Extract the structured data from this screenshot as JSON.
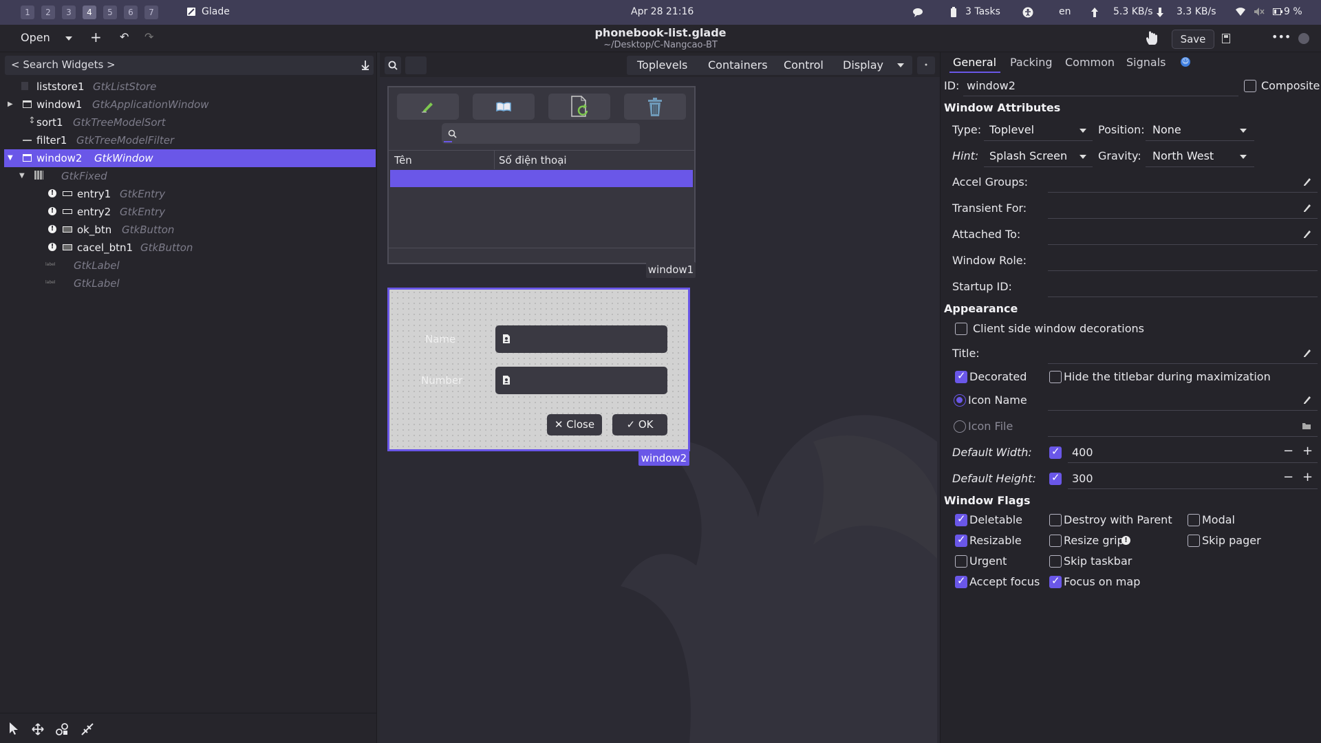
{
  "sysbar": {
    "workspaces": [
      "1",
      "2",
      "3",
      "4",
      "5",
      "6",
      "7"
    ],
    "app_name": "Glade",
    "datetime": "Apr 28  21:16",
    "tasks": "3 Tasks",
    "lang": "en",
    "net_up": "5.3 KB/s",
    "net_down": "3.3 KB/s",
    "battery": "9 %"
  },
  "header": {
    "open_label": "Open",
    "title": "phonebook-list.glade",
    "subtitle": "~/Desktop/C-Nangcao-BT",
    "save_label": "Save"
  },
  "left": {
    "search_label": "< Search Widgets >",
    "tree": [
      {
        "name": "liststore1",
        "type": "GtkListStore"
      },
      {
        "name": "window1",
        "type": "GtkApplicationWindow"
      },
      {
        "name": "sort1",
        "type": "GtkTreeModelSort"
      },
      {
        "name": "filter1",
        "type": "GtkTreeModelFilter"
      },
      {
        "name": "window2",
        "type": "GtkWindow"
      },
      {
        "name": "",
        "type": "GtkFixed"
      },
      {
        "name": "entry1",
        "type": "GtkEntry"
      },
      {
        "name": "entry2",
        "type": "GtkEntry"
      },
      {
        "name": "ok_btn",
        "type": "GtkButton"
      },
      {
        "name": "cacel_btn1",
        "type": "GtkButton"
      },
      {
        "name": "",
        "type": "GtkLabel"
      },
      {
        "name": "",
        "type": "GtkLabel"
      }
    ]
  },
  "palette": {
    "toplevels": "Toplevels",
    "containers": "Containers",
    "control": "Control",
    "display": "Display"
  },
  "window1": {
    "col1": "Tên",
    "col2": "Số điện thoại",
    "tag": "window1"
  },
  "window2": {
    "name_label": "Name",
    "number_label": "Number",
    "close_label": "✕ Close",
    "ok_label": "✓ OK",
    "tag": "window2"
  },
  "right": {
    "tabs": [
      "General",
      "Packing",
      "Common",
      "Signals"
    ],
    "id_label": "ID:",
    "id_value": "window2",
    "composite": "Composite",
    "window_attributes": "Window Attributes",
    "type_label": "Type:",
    "type_value": "Toplevel",
    "position_label": "Position:",
    "position_value": "None",
    "hint_label": "Hint:",
    "hint_value": "Splash Screen",
    "gravity_label": "Gravity:",
    "gravity_value": "North West",
    "accel_groups": "Accel Groups:",
    "transient_for": "Transient For:",
    "attached_to": "Attached To:",
    "window_role": "Window Role:",
    "startup_id": "Startup ID:",
    "appearance": "Appearance",
    "csd": "Client side window decorations",
    "title_label": "Title:",
    "decorated": "Decorated",
    "hide_titlebar": "Hide the titlebar during maximization",
    "icon_name": "Icon Name",
    "icon_file": "Icon File",
    "default_width_label": "Default Width:",
    "default_width_value": "400",
    "default_height_label": "Default Height:",
    "default_height_value": "300",
    "window_flags": "Window Flags",
    "flags": {
      "deletable": "Deletable",
      "destroy_with_parent": "Destroy with Parent",
      "modal": "Modal",
      "resizable": "Resizable",
      "resize_grip": "Resize grip",
      "skip_pager": "Skip pager",
      "urgent": "Urgent",
      "skip_taskbar": "Skip taskbar",
      "accept_focus": "Accept focus",
      "focus_on_map": "Focus on map"
    }
  },
  "colors": {
    "accent": "#6a57e8",
    "sysbar": "#3f3d56",
    "panel": "#26252b"
  }
}
